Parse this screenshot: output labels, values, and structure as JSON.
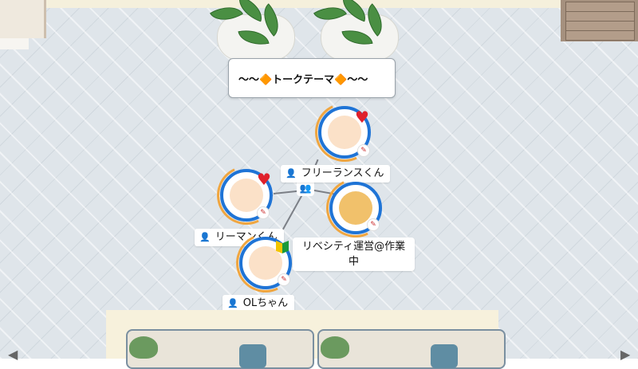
{
  "topic": {
    "text": "〜〜🔶トークテーマ🔶〜〜"
  },
  "hub": {
    "icon": "group-icon"
  },
  "users": [
    {
      "name": "フリーランスくん",
      "heart": true
    },
    {
      "name": "リーマンくん",
      "heart": true
    },
    {
      "name": "リベシティ運営@作業中",
      "status_line1": "リベシティ運営@作業",
      "status_line2": "中"
    },
    {
      "name": "OLちゃん",
      "beginner_mark": true
    }
  ],
  "colors": {
    "ring": "#1f74d6",
    "arc": "#f0a640",
    "heart": "#e0212b",
    "link": "#7b7f86"
  }
}
